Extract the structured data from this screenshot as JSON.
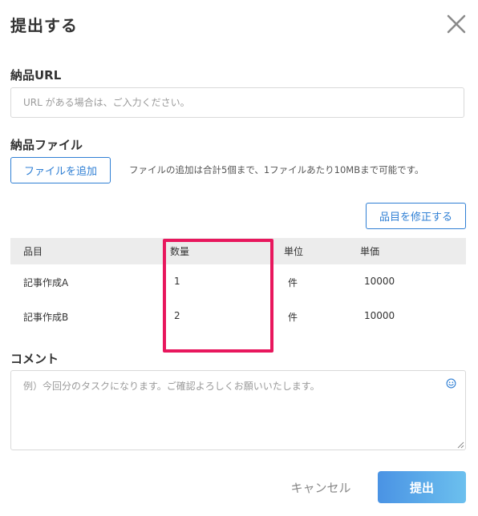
{
  "dialog": {
    "title": "提出する"
  },
  "url_section": {
    "label": "納品URL",
    "placeholder": "URL がある場合は、ご入力ください。",
    "value": ""
  },
  "file_section": {
    "label": "納品ファイル",
    "add_button": "ファイルを追加",
    "hint": "ファイルの追加は合計5個まで、1ファイルあたり10MBまで可能です。"
  },
  "items": {
    "edit_button": "品目を修正する",
    "headers": {
      "item": "品目",
      "quantity": "数量",
      "unit": "単位",
      "price": "単価"
    },
    "rows": [
      {
        "item": "記事作成A",
        "quantity": "1",
        "unit": "件",
        "price": "10000"
      },
      {
        "item": "記事作成B",
        "quantity": "2",
        "unit": "件",
        "price": "10000"
      }
    ]
  },
  "comment_section": {
    "label": "コメント",
    "placeholder": "例）今回分のタスクになります。ご確認よろしくお願いいたします。",
    "value": ""
  },
  "footer": {
    "cancel": "キャンセル",
    "submit": "提出"
  },
  "colors": {
    "accent": "#2f7fd4",
    "highlight": "#e8175d",
    "submit_start": "#4a93e4",
    "submit_end": "#6cc0ee"
  },
  "icons": {
    "close": "close-icon",
    "emoji": "smiley-icon",
    "resize": "resize-handle-icon"
  }
}
